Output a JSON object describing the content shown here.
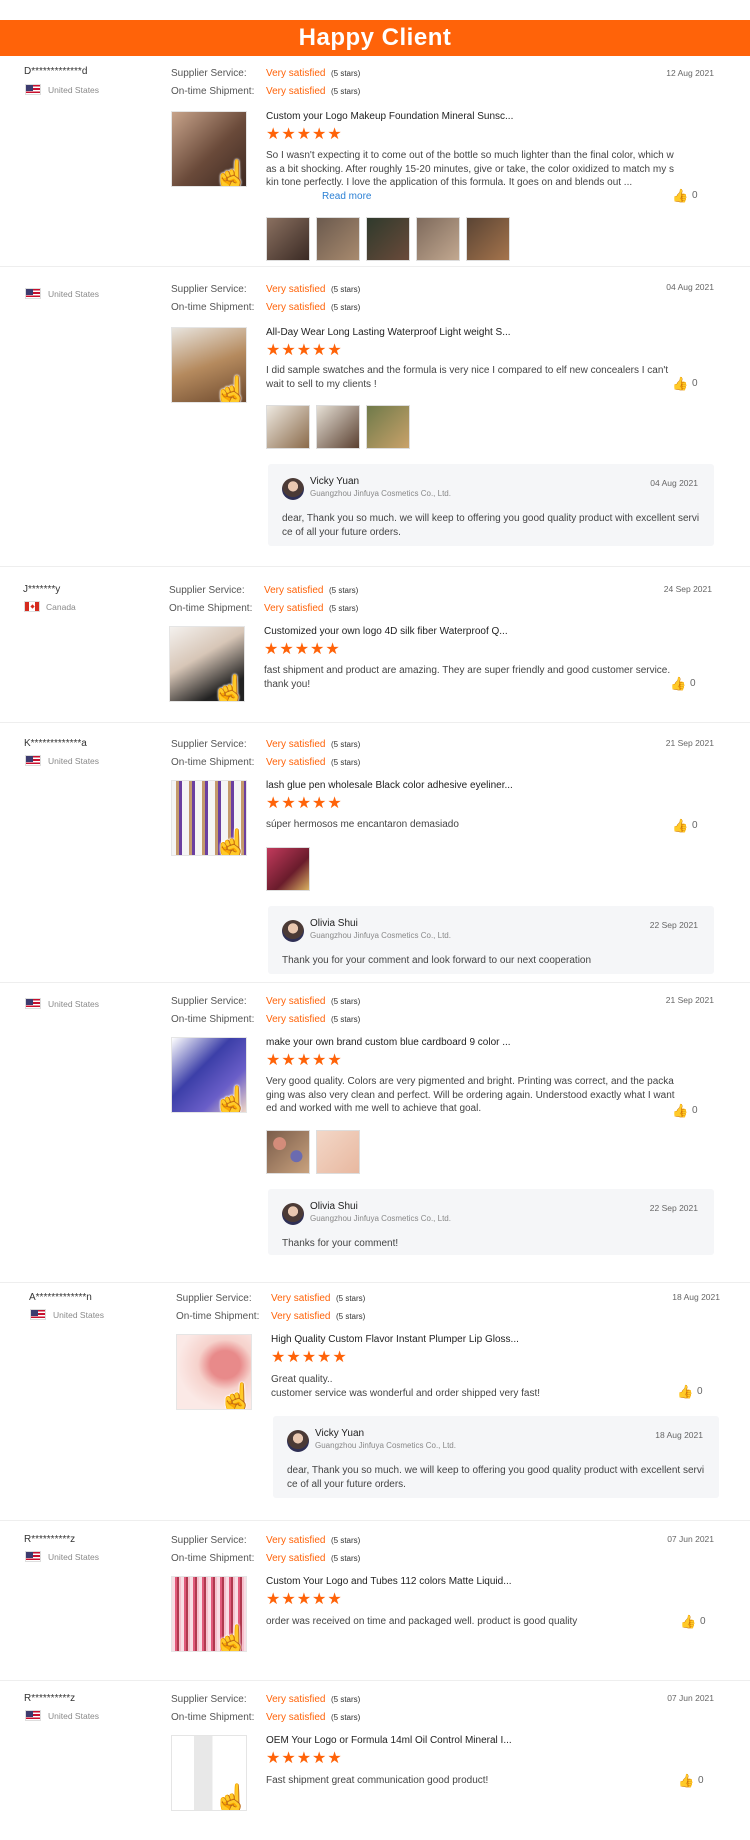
{
  "banner": {
    "title": "Happy Client"
  },
  "labels": {
    "supplier_service": "Supplier Service:",
    "on_time_shipment": "On-time Shipment:",
    "read_more": "Read more"
  },
  "reviews": [
    {
      "buyer": "D*************d",
      "country": "United States",
      "supplier_service": "Very satisfied",
      "supplier_stars": "(5 stars)",
      "shipment": "Very satisfied",
      "shipment_stars": "(5 stars)",
      "date": "12 Aug 2021",
      "product_title": "Custom your Logo Makeup Foundation Mineral Sunsc...",
      "stars": "★★★★★",
      "text": "So I wasn't expecting it to come out of the bottle so much lighter than the final color, which was a bit shocking. After roughly 15-20 minutes, give or take, the color oxidized to match my skin tone perfectly. I love the application of this formula. It goes on and blends out ...",
      "likes": "0"
    },
    {
      "buyer": "",
      "country": "United States",
      "supplier_service": "Very satisfied",
      "supplier_stars": "(5 stars)",
      "shipment": "Very satisfied",
      "shipment_stars": "(5 stars)",
      "date": "04 Aug 2021",
      "product_title": "All-Day Wear Long Lasting Waterproof Light weight S...",
      "stars": "★★★★★",
      "text": "I did sample swatches and the formula is very nice I compared to elf new concealers I can't wait to sell to my clients !",
      "likes": "0",
      "reply": {
        "name": "Vicky Yuan",
        "company": "Guangzhou Jinfuya Cosmetics Co., Ltd.",
        "date": "04 Aug 2021",
        "text": "dear, Thank you so much. we will keep to offering you good quality product with excellent service of all your future orders."
      }
    },
    {
      "buyer": "J*******y",
      "country": "Canada",
      "supplier_service": "Very satisfied",
      "supplier_stars": "(5 stars)",
      "shipment": "Very satisfied",
      "shipment_stars": "(5 stars)",
      "date": "24 Sep 2021",
      "product_title": "Customized your own logo 4D silk fiber Waterproof Q...",
      "stars": "★★★★★",
      "text": "fast shipment and product are amazing. They are super friendly and good customer service. thank you!",
      "likes": "0"
    },
    {
      "buyer": "K*************a",
      "country": "United States",
      "supplier_service": "Very satisfied",
      "supplier_stars": "(5 stars)",
      "shipment": "Very satisfied",
      "shipment_stars": "(5 stars)",
      "date": "21 Sep 2021",
      "product_title": "lash glue pen wholesale Black color adhesive eyeliner...",
      "stars": "★★★★★",
      "text": "súper hermosos me encantaron demasiado",
      "likes": "0",
      "reply": {
        "name": "Olivia Shui",
        "company": "Guangzhou Jinfuya Cosmetics Co., Ltd.",
        "date": "22 Sep 2021",
        "text": "Thank you for your comment and look forward to our next cooperation"
      }
    },
    {
      "buyer": "",
      "country": "United States",
      "supplier_service": "Very satisfied",
      "supplier_stars": "(5 stars)",
      "shipment": "Very satisfied",
      "shipment_stars": "(5 stars)",
      "date": "21 Sep 2021",
      "product_title": "make your own brand custom blue cardboard 9 color ...",
      "stars": "★★★★★",
      "text": "Very good quality. Colors are very pigmented and bright. Printing was correct, and the packaging was also very clean and perfect. Will be ordering again. Understood exactly what I wanted and worked with me well to achieve that goal.",
      "likes": "0",
      "reply": {
        "name": "Olivia Shui",
        "company": "Guangzhou Jinfuya Cosmetics Co., Ltd.",
        "date": "22 Sep 2021",
        "text": "Thanks for your comment!"
      }
    },
    {
      "buyer": "A*************n",
      "country": "United States",
      "supplier_service": "Very satisfied",
      "supplier_stars": "(5 stars)",
      "shipment": "Very satisfied",
      "shipment_stars": "(5 stars)",
      "date": "18 Aug 2021",
      "product_title": "High Quality Custom Flavor Instant Plumper Lip Gloss...",
      "stars": "★★★★★",
      "text": "Great quality..\ncustomer service was wonderful and order shipped very fast!",
      "likes": "0",
      "reply": {
        "name": "Vicky Yuan",
        "company": "Guangzhou Jinfuya Cosmetics Co., Ltd.",
        "date": "18 Aug 2021",
        "text": "dear, Thank you so much. we will keep to offering you good quality product with excellent service of all your future orders."
      }
    },
    {
      "buyer": "R**********z",
      "country": "United States",
      "supplier_service": "Very satisfied",
      "supplier_stars": "(5 stars)",
      "shipment": "Very satisfied",
      "shipment_stars": "(5 stars)",
      "date": "07 Jun 2021",
      "product_title": "Custom Your Logo and Tubes 112 colors Matte Liquid...",
      "stars": "★★★★★",
      "text": "order was received on time and packaged well. product is good quality",
      "likes": "0"
    },
    {
      "buyer": "R**********z",
      "country": "United States",
      "supplier_service": "Very satisfied",
      "supplier_stars": "(5 stars)",
      "shipment": "Very satisfied",
      "shipment_stars": "(5 stars)",
      "date": "07 Jun 2021",
      "product_title": "OEM Your Logo or Formula 14ml Oil Control Mineral I...",
      "stars": "★★★★★",
      "text": "Fast shipment great communication good product!",
      "likes": "0"
    }
  ]
}
